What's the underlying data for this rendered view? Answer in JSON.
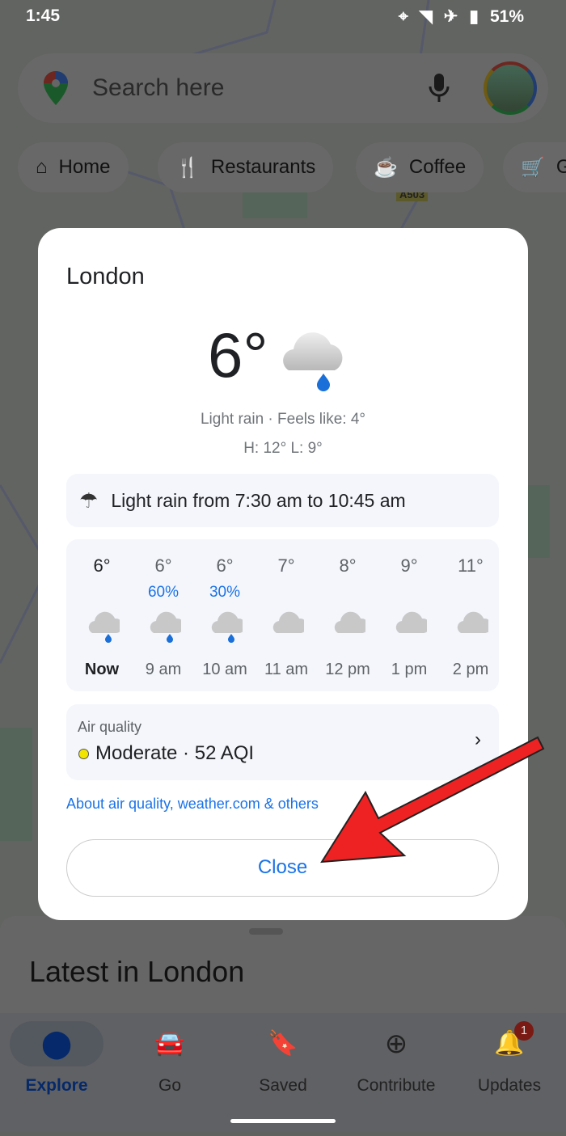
{
  "status": {
    "time": "1:45",
    "battery": "51%"
  },
  "search": {
    "placeholder": "Search here"
  },
  "chips": [
    {
      "label": "Home",
      "icon": "home-icon"
    },
    {
      "label": "Restaurants",
      "icon": "restaurant-icon"
    },
    {
      "label": "Coffee",
      "icon": "coffee-icon"
    },
    {
      "label": "G",
      "icon": "cart-icon"
    }
  ],
  "map": {
    "road_label": "A503"
  },
  "weather": {
    "city": "London",
    "temp": "6°",
    "condition": "Light rain · Feels like: 4°",
    "hilo": "H: 12° L: 9°",
    "alert": "Light rain from 7:30 am to 10:45 am",
    "hourly": [
      {
        "temp": "6°",
        "precip": "",
        "time": "Now",
        "icon": "rain"
      },
      {
        "temp": "6°",
        "precip": "60%",
        "time": "9 am",
        "icon": "rain"
      },
      {
        "temp": "6°",
        "precip": "30%",
        "time": "10 am",
        "icon": "rain"
      },
      {
        "temp": "7°",
        "precip": "",
        "time": "11 am",
        "icon": "cloud"
      },
      {
        "temp": "8°",
        "precip": "",
        "time": "12 pm",
        "icon": "cloud"
      },
      {
        "temp": "9°",
        "precip": "",
        "time": "1 pm",
        "icon": "cloud"
      },
      {
        "temp": "11°",
        "precip": "",
        "time": "2 pm",
        "icon": "cloud"
      }
    ],
    "air_label": "Air quality",
    "air_value": "Moderate · 52 AQI",
    "air_color": "#f2e600",
    "sources": "About air quality, weather.com & others",
    "close": "Close"
  },
  "sheet": {
    "title": "Latest in London"
  },
  "nav": [
    {
      "label": "Explore",
      "active": true
    },
    {
      "label": "Go"
    },
    {
      "label": "Saved"
    },
    {
      "label": "Contribute"
    },
    {
      "label": "Updates",
      "badge": "1"
    }
  ]
}
